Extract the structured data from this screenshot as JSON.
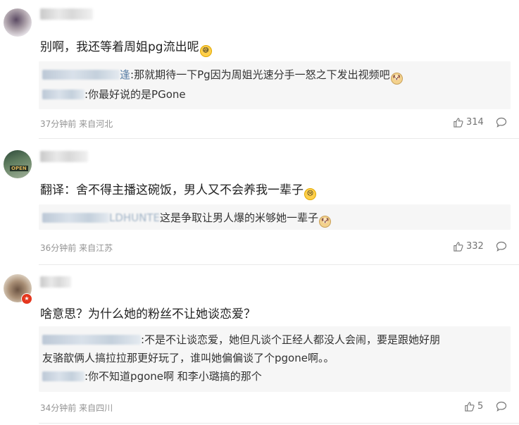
{
  "comments": [
    {
      "text": "别啊，我还等着周姐pg流出呢",
      "emoji": "sweat-emoji",
      "replies": [
        {
          "name_visible": "逢",
          "text": ":那就期待一下Pg因为周姐光速分手一怒之下发出视频吧",
          "emoji": "doge-emoji"
        },
        {
          "name_visible": "",
          "text": ":你最好说的是PGone"
        }
      ],
      "time": "37分钟前 来自河北",
      "likes": "314"
    },
    {
      "text": "翻译：舍不得主播这碗饭，男人又不会养我一辈子",
      "emoji": "cry-emoji",
      "avatar_sign": "OPEN",
      "replies": [
        {
          "name_visible": "LDHUNTE",
          "text": "这是争取让男人爆的米够她一辈子",
          "emoji": "doge-emoji"
        }
      ],
      "time": "36分钟前 来自江苏",
      "likes": "332"
    },
    {
      "text": "啥意思？为什么她的粉丝不让她谈恋爱？",
      "replies": [
        {
          "name_visible": "",
          "text": ":不是不让谈恋爱，她但凡谈个正经人都没人会闹，要是跟她好朋",
          "cont": "友骆歆俩人搞拉拉那更好玩了，谁叫她偏偏谈了个pgone啊。。"
        },
        {
          "name_visible": "",
          "text": ":你不知道pgone啊 和李小璐搞的那个"
        }
      ],
      "time": "34分钟前 来自四川",
      "likes": "5"
    }
  ]
}
